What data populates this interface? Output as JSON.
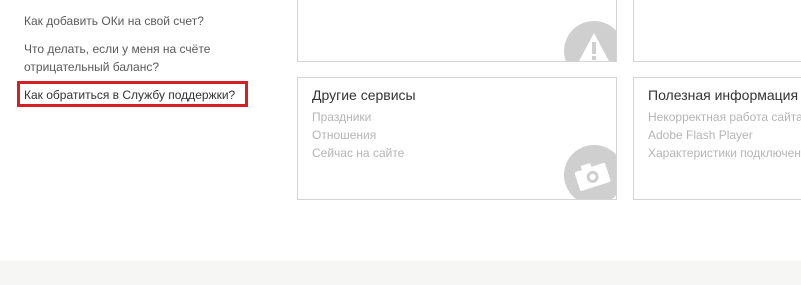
{
  "faq": {
    "q1": "Как добавить ОКи на свой счет?",
    "q2_line1": "Что делать, если у меня на счёте",
    "q2_line2": "отрицательный баланс?",
    "q3": "Как обратиться в Службу поддержки?"
  },
  "cards": {
    "other_services": {
      "title": "Другие сервисы",
      "links": [
        "Праздники",
        "Отношения",
        "Сейчас на сайте"
      ]
    },
    "useful_info": {
      "title": "Полезная информация",
      "links": [
        "Некорректная работа сайта",
        "Adobe Flash Player",
        "Характеристики подключения"
      ]
    }
  },
  "colors": {
    "highlight_border": "#d51f26",
    "icon_gray": "#cfcfcf",
    "footer_band": "#f6f7f5"
  },
  "icons": [
    "warning-icon",
    "camera-icon"
  ]
}
